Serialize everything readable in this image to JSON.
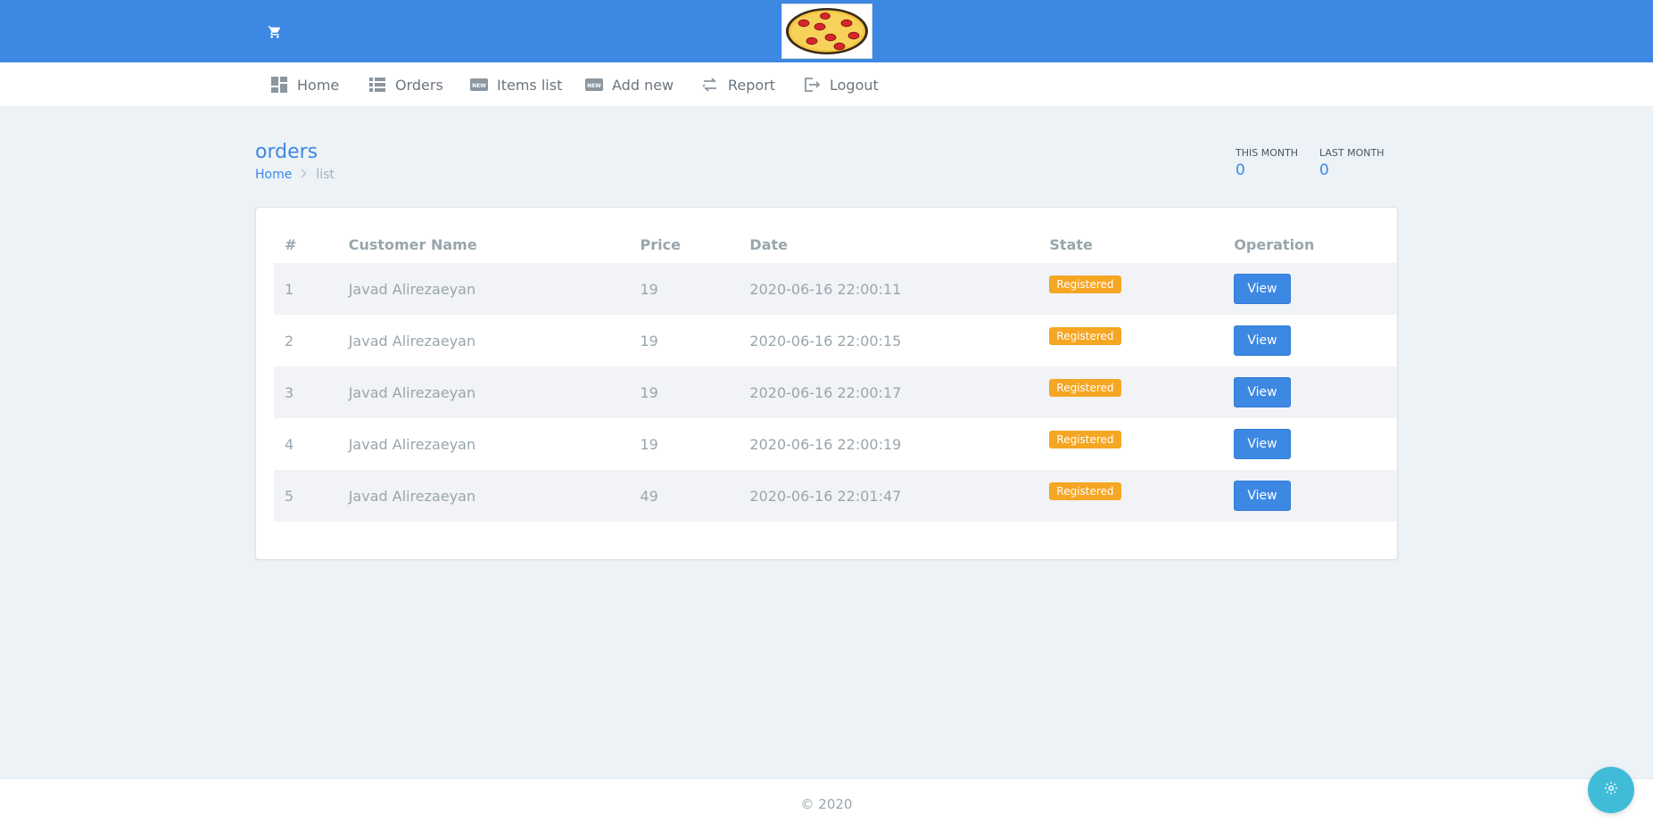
{
  "header": {
    "cart_icon": "cart-icon",
    "logo_icon": "pizza-logo"
  },
  "nav": [
    {
      "label": "Home",
      "icon": "dashboard-icon"
    },
    {
      "label": "Orders",
      "icon": "list-icon"
    },
    {
      "label": "Items list",
      "icon": "new-badge-icon"
    },
    {
      "label": "Add new",
      "icon": "new-badge-icon"
    },
    {
      "label": "Report",
      "icon": "swap-icon"
    },
    {
      "label": "Logout",
      "icon": "logout-icon"
    }
  ],
  "page": {
    "title": "orders",
    "breadcrumb": {
      "home": "Home",
      "separator": ">",
      "current": "list"
    }
  },
  "stats": [
    {
      "label": "THIS MONTH",
      "value": "0"
    },
    {
      "label": "LAST MONTH",
      "value": "0"
    }
  ],
  "table": {
    "columns": [
      "#",
      "Customer Name",
      "Price",
      "Date",
      "State",
      "Operation"
    ],
    "rows": [
      {
        "num": "1",
        "customer": "Javad Alirezaeyan",
        "price": "19",
        "date": "2020-06-16 22:00:11",
        "state": "Registered",
        "action": "View"
      },
      {
        "num": "2",
        "customer": "Javad Alirezaeyan",
        "price": "19",
        "date": "2020-06-16 22:00:15",
        "state": "Registered",
        "action": "View"
      },
      {
        "num": "3",
        "customer": "Javad Alirezaeyan",
        "price": "19",
        "date": "2020-06-16 22:00:17",
        "state": "Registered",
        "action": "View"
      },
      {
        "num": "4",
        "customer": "Javad Alirezaeyan",
        "price": "19",
        "date": "2020-06-16 22:00:19",
        "state": "Registered",
        "action": "View"
      },
      {
        "num": "5",
        "customer": "Javad Alirezaeyan",
        "price": "49",
        "date": "2020-06-16 22:01:47",
        "state": "Registered",
        "action": "View"
      }
    ]
  },
  "footer": {
    "copyright": "© 2020"
  },
  "colors": {
    "primary": "#3d88e3",
    "badge": "#f5a623",
    "fab": "#40bcd8",
    "background": "#edf2f7"
  }
}
